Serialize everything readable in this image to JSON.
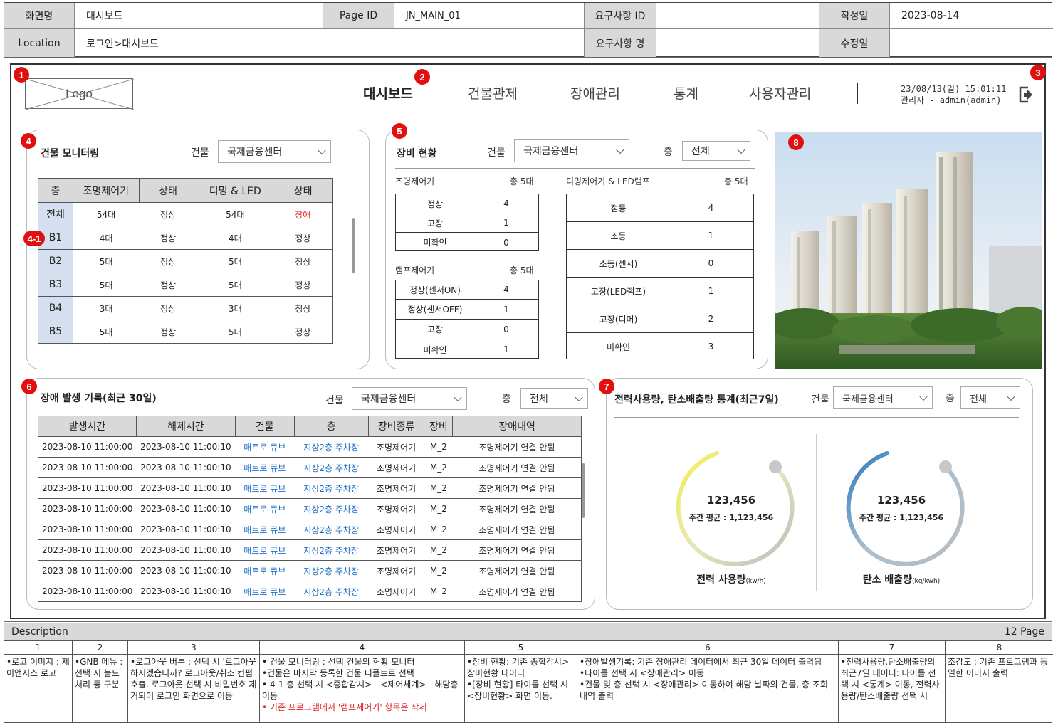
{
  "spec": {
    "screen_name_label": "화면명",
    "screen_name": "대시보드",
    "page_id_label": "Page ID",
    "page_id": "JN_MAIN_01",
    "req_id_label": "요구사항 ID",
    "req_id": "",
    "created_label": "작성일",
    "created": "2023-08-14",
    "location_label": "Location",
    "location": "로그인>대시보드",
    "req_name_label": "요구사항 명",
    "req_name": "",
    "modified_label": "수정일",
    "modified": ""
  },
  "markers": {
    "m1": "1",
    "m2": "2",
    "m3": "3",
    "m4": "4",
    "m41": "4-1",
    "m5": "5",
    "m6": "6",
    "m7": "7",
    "m8": "8"
  },
  "gnb": {
    "logo": "Logo",
    "menu": [
      "대시보드",
      "건물관제",
      "장애관리",
      "통계",
      "사용자관리"
    ],
    "datetime": "23/08/13(일) 15:01:11",
    "user": "관리자 - admin(admin)"
  },
  "monitoring": {
    "title": "건물 모니터링",
    "building_label": "건물",
    "building": "국제금융센터",
    "columns": [
      "층",
      "조명제어기",
      "상태",
      "디밍 & LED",
      "상태"
    ],
    "rows": [
      [
        "전체",
        "54대",
        "정상",
        "54대",
        "장애"
      ],
      [
        "B1",
        "4대",
        "정상",
        "4대",
        "정상"
      ],
      [
        "B2",
        "5대",
        "정상",
        "5대",
        "정상"
      ],
      [
        "B3",
        "5대",
        "정상",
        "5대",
        "정상"
      ],
      [
        "B4",
        "3대",
        "정상",
        "3대",
        "정상"
      ],
      [
        "B5",
        "5대",
        "정상",
        "5대",
        "정상"
      ]
    ]
  },
  "equipment": {
    "title": "장비 현황",
    "building_label": "건물",
    "building": "국제금융센터",
    "floor_label": "층",
    "floor": "전체",
    "lighting": {
      "title": "조명제어기",
      "total": "총 5대",
      "rows": [
        [
          "정상",
          "4"
        ],
        [
          "고장",
          "1"
        ],
        [
          "미확인",
          "0"
        ]
      ]
    },
    "lamp": {
      "title": "램프제어기",
      "total": "총 5대",
      "rows": [
        [
          "정상(센서ON)",
          "4"
        ],
        [
          "정상(센서OFF)",
          "1"
        ],
        [
          "고장",
          "0"
        ],
        [
          "미확인",
          "1"
        ]
      ]
    },
    "dimming": {
      "title": "디밍제어기 & LED램프",
      "total": "총 5대",
      "rows": [
        [
          "점등",
          "4"
        ],
        [
          "소등",
          "1"
        ],
        [
          "소등(센서)",
          "0"
        ],
        [
          "고장(LED램프)",
          "1"
        ],
        [
          "고장(디머)",
          "2"
        ],
        [
          "미확인",
          "3"
        ]
      ]
    }
  },
  "faults": {
    "title": "장애 발생 기록(최근 30일)",
    "building_label": "건물",
    "building": "국제금융센터",
    "floor_label": "층",
    "floor": "전체",
    "columns": [
      "발생시간",
      "해제시간",
      "건물",
      "층",
      "장비종류",
      "장비",
      "장애내역"
    ],
    "rows": [
      [
        "2023-08-10 11:00:00",
        "2023-08-10 11:00:10",
        "매트로 큐브",
        "지상2층 주차장",
        "조명제어기",
        "M_2",
        "조명제어기 연결 안됨"
      ],
      [
        "2023-08-10 11:00:00",
        "2023-08-10 11:00:10",
        "매트로 큐브",
        "지상2층 주차장",
        "조명제어기",
        "M_2",
        "조명제어기 연결 안됨"
      ],
      [
        "2023-08-10 11:00:00",
        "2023-08-10 11:00:10",
        "매트로 큐브",
        "지상2층 주차장",
        "조명제어기",
        "M_2",
        "조명제어기 연결 안됨"
      ],
      [
        "2023-08-10 11:00:00",
        "2023-08-10 11:00:10",
        "매트로 큐브",
        "지상2층 주차장",
        "조명제어기",
        "M_2",
        "조명제어기 연결 안됨"
      ],
      [
        "2023-08-10 11:00:00",
        "2023-08-10 11:00:10",
        "매트로 큐브",
        "지상2층 주차장",
        "조명제어기",
        "M_2",
        "조명제어기 연결 안됨"
      ],
      [
        "2023-08-10 11:00:00",
        "2023-08-10 11:00:10",
        "매트로 큐브",
        "지상2층 주차장",
        "조명제어기",
        "M_2",
        "조명제어기 연결 안됨"
      ],
      [
        "2023-08-10 11:00:00",
        "2023-08-10 11:00:10",
        "매트로 큐브",
        "지상2층 주차장",
        "조명제어기",
        "M_2",
        "조명제어기 연결 안됨"
      ],
      [
        "2023-08-10 11:00:00",
        "2023-08-10 11:00:10",
        "매트로 큐브",
        "지상2층 주차장",
        "조명제어기",
        "M_2",
        "조명제어기 연결 안됨"
      ]
    ]
  },
  "stats": {
    "title": "전력사용량, 탄소배출량 통계(최근7일)",
    "building_label": "건물",
    "building": "국제금융센터",
    "floor_label": "층",
    "floor": "전체",
    "power": {
      "value": "123,456",
      "avg": "주간 평균 : 1,123,456",
      "name": "전력 사용량",
      "unit": "(kw/h)",
      "color": "#f0ee60"
    },
    "carbon": {
      "value": "123,456",
      "avg": "주간 평균 : 1,123,456",
      "name": "탄소 배출량",
      "unit": "(kg/kwh)",
      "color": "#2f7fc0"
    }
  },
  "description": {
    "label": "Description",
    "page": "12 Page",
    "cols": [
      {
        "h": "1",
        "b": "•로고 이미지 : 제이앤시스 로고"
      },
      {
        "h": "2",
        "b": "•GNB 메뉴 : 선택 시 볼드처리 등 구분"
      },
      {
        "h": "3",
        "b": "•로그아웃 버튼 : 선택 시 '로그아웃 하시겠습니까? 로그아웃/취소'컨펌 호출. 로그아웃 선택 시 비밀번호 제거되어 로그인 화면으로 이동"
      },
      {
        "h": "4",
        "b": "• 건물 모니터링 : 선택 건물의 현황 모니터\n•건물은 마지막 등록한 건물 디폴트로 선택\n• 4-1 층 선택 시 <종합감시> - <제어체계> - 해당층 이동",
        "red": "• 기존 프로그램에서 '램프제어기' 항목은 삭제"
      },
      {
        "h": "5",
        "b": "•장비 현황: 기존 종합감시>장비현황 데이터\n•[장비 현황] 타이틀 선택 시 <장비현황> 화면 이동."
      },
      {
        "h": "6",
        "b": "•장애발생기록: 기존 장애관리 데이터에서 최근 30일 데이터 출력됨\n•타이틀 선택 시 <장애관리> 이동\n•건물 및 층 선택 시 <장애관리> 이동하여 해당 날짜의 건물, 층 조회 내역 출력"
      },
      {
        "h": "7",
        "b": "•전력사용량,탄소배출량의 최근7일 데이터: 타이틀 선택 시 <통계> 이동, 전력사용량/탄소배출량 선택 시"
      },
      {
        "h": "8",
        "b": "조감도 : 기존 프로그램과 동일한 이미지 출력"
      }
    ]
  }
}
